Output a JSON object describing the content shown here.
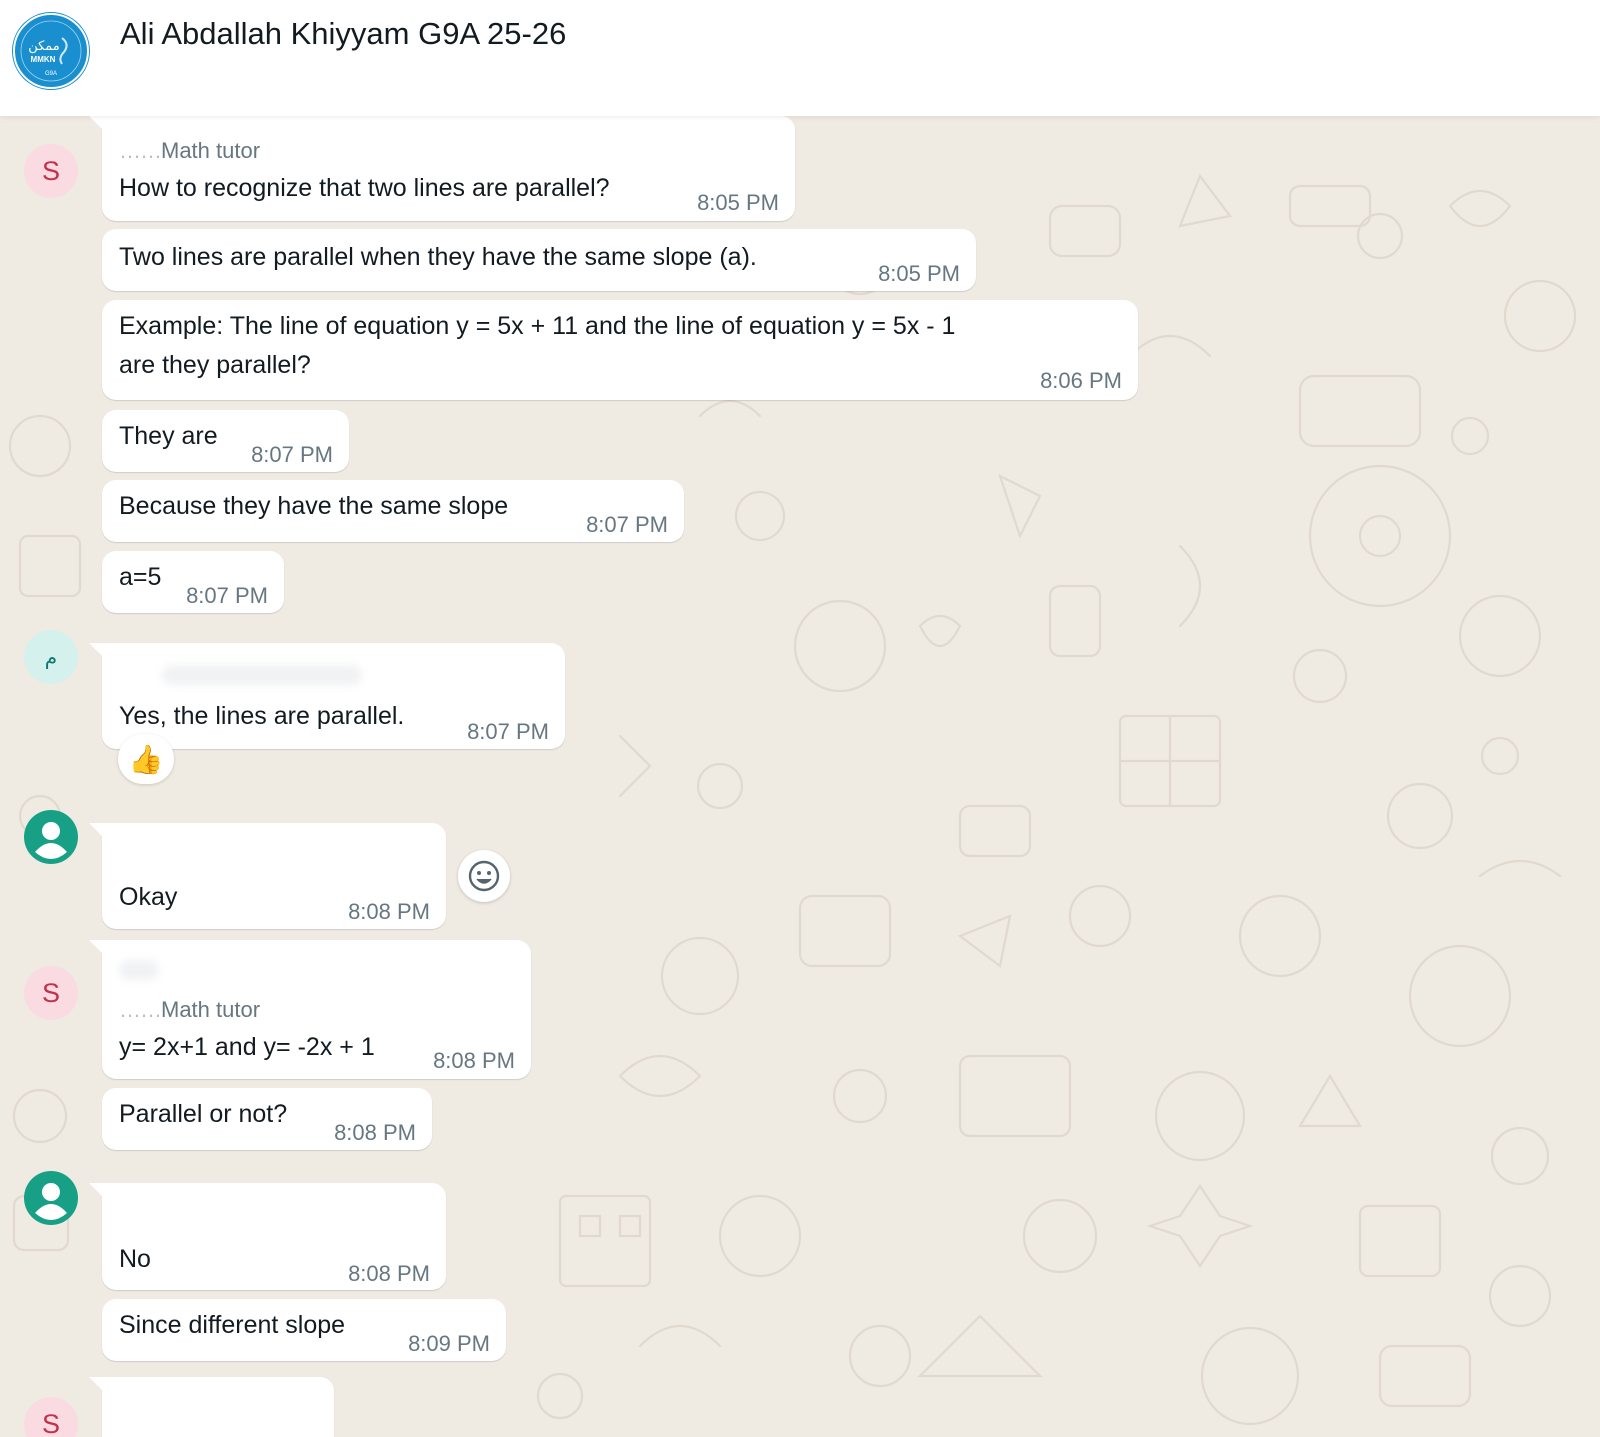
{
  "header": {
    "title": "Ali Abdallah Khiyyam G9A 25-26",
    "avatar": {
      "icon": "group-logo",
      "line1": "ممكن",
      "line2": "MMKN",
      "line3": "G9A",
      "color": "#1a8fd0"
    }
  },
  "messages": [
    {
      "avatar": "S",
      "sender": {
        "name": "……",
        "role": "Math tutor"
      },
      "bubbles": [
        {
          "text": "How to recognize that two lines are parallel?",
          "time": "8:05 PM"
        },
        {
          "text": "Two lines are parallel when they have the same slope (a).",
          "time": "8:05 PM"
        },
        {
          "text": "Example: The line of equation y = 5x + 11 and the line of equation y = 5x - 1",
          "text2": "are they parallel?",
          "time": "8:06 PM"
        },
        {
          "text": "They are",
          "time": "8:07 PM"
        },
        {
          "text": "Because they have the same slope",
          "time": "8:07 PM"
        },
        {
          "text": "a=5",
          "time": "8:07 PM"
        }
      ]
    },
    {
      "avatar": "م",
      "bubbles": [
        {
          "text": "Yes, the lines are parallel.",
          "time": "8:07 PM",
          "reaction": "👍"
        }
      ]
    },
    {
      "avatar": "person-icon",
      "bubbles": [
        {
          "text": "Okay",
          "time": "8:08 PM"
        }
      ]
    },
    {
      "avatar": "S",
      "sender": {
        "name": "……",
        "role": "Math tutor"
      },
      "bubbles": [
        {
          "text": "y= 2x+1 and y= -2x + 1",
          "time": "8:08 PM"
        },
        {
          "text": "Parallel or not?",
          "time": "8:08 PM"
        }
      ]
    },
    {
      "avatar": "person-icon",
      "bubbles": [
        {
          "text": "No",
          "time": "8:08 PM"
        },
        {
          "text": "Since different slope",
          "time": "8:09 PM"
        }
      ]
    },
    {
      "avatar": "S",
      "bubbles": []
    }
  ],
  "colors": {
    "wallpaper": "#efeae2",
    "bubble": "#ffffff",
    "avatar_s_bg": "#fadbe2",
    "avatar_s_fg": "#c4314b",
    "person_avatar": "#17a085"
  },
  "icons": {
    "react": "emoji-smiley-icon",
    "person": "person-icon"
  }
}
